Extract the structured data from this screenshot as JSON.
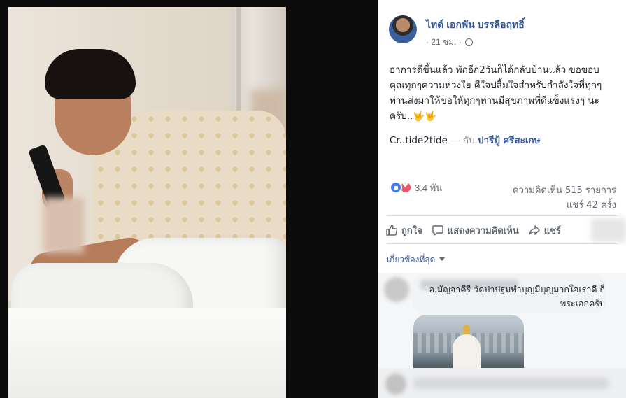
{
  "post": {
    "author": "ไทด์ เอกพัน บรรลือฤทธิ์",
    "time": "21 ชม.",
    "separator": "·",
    "body": "อาการดีขึ้นแล้ว พักอีก2วันก็ได้กลับบ้านแล้ว ขอขอบคุณทุกๆความห่วงใย ดีใจปลื้มใจสำหรับกำลังใจที่ทุกๆท่านส่งมาให้ขอให้ทุกๆท่านมีสุขภาพที่ดีแข็งแรงๆ นะครับ..🤟🤟",
    "credit": "Cr..tide2tide",
    "with_dash": "— กับ",
    "tagged": "ปารีปู้ ศรีสะเกษ"
  },
  "stats": {
    "reactions": "3.4 พัน",
    "comments": "ความคิดเห็น 515 รายการ",
    "shares": "แชร์ 42 ครั้ง"
  },
  "actions": {
    "like": "ถูกใจ",
    "comment": "แสดงความคิดเห็น",
    "share": "แชร์"
  },
  "sort_label": "เกี่ยวข้องที่สุด",
  "comment": {
    "text": "อ.มัญจาคีรี วัดป่าปฐมทำบุญมีบุญมากใจเราดี ก็พระเอกครับ"
  },
  "icons": {
    "privacy": "globe-icon",
    "like": "thumbs-up-icon",
    "comment": "speech-bubble-icon",
    "share": "share-arrow-icon"
  },
  "colors": {
    "link": "#365899",
    "text": "#1d2129",
    "muted": "#616770",
    "like_reaction": "#4080ff",
    "love_reaction": "#f25268"
  }
}
